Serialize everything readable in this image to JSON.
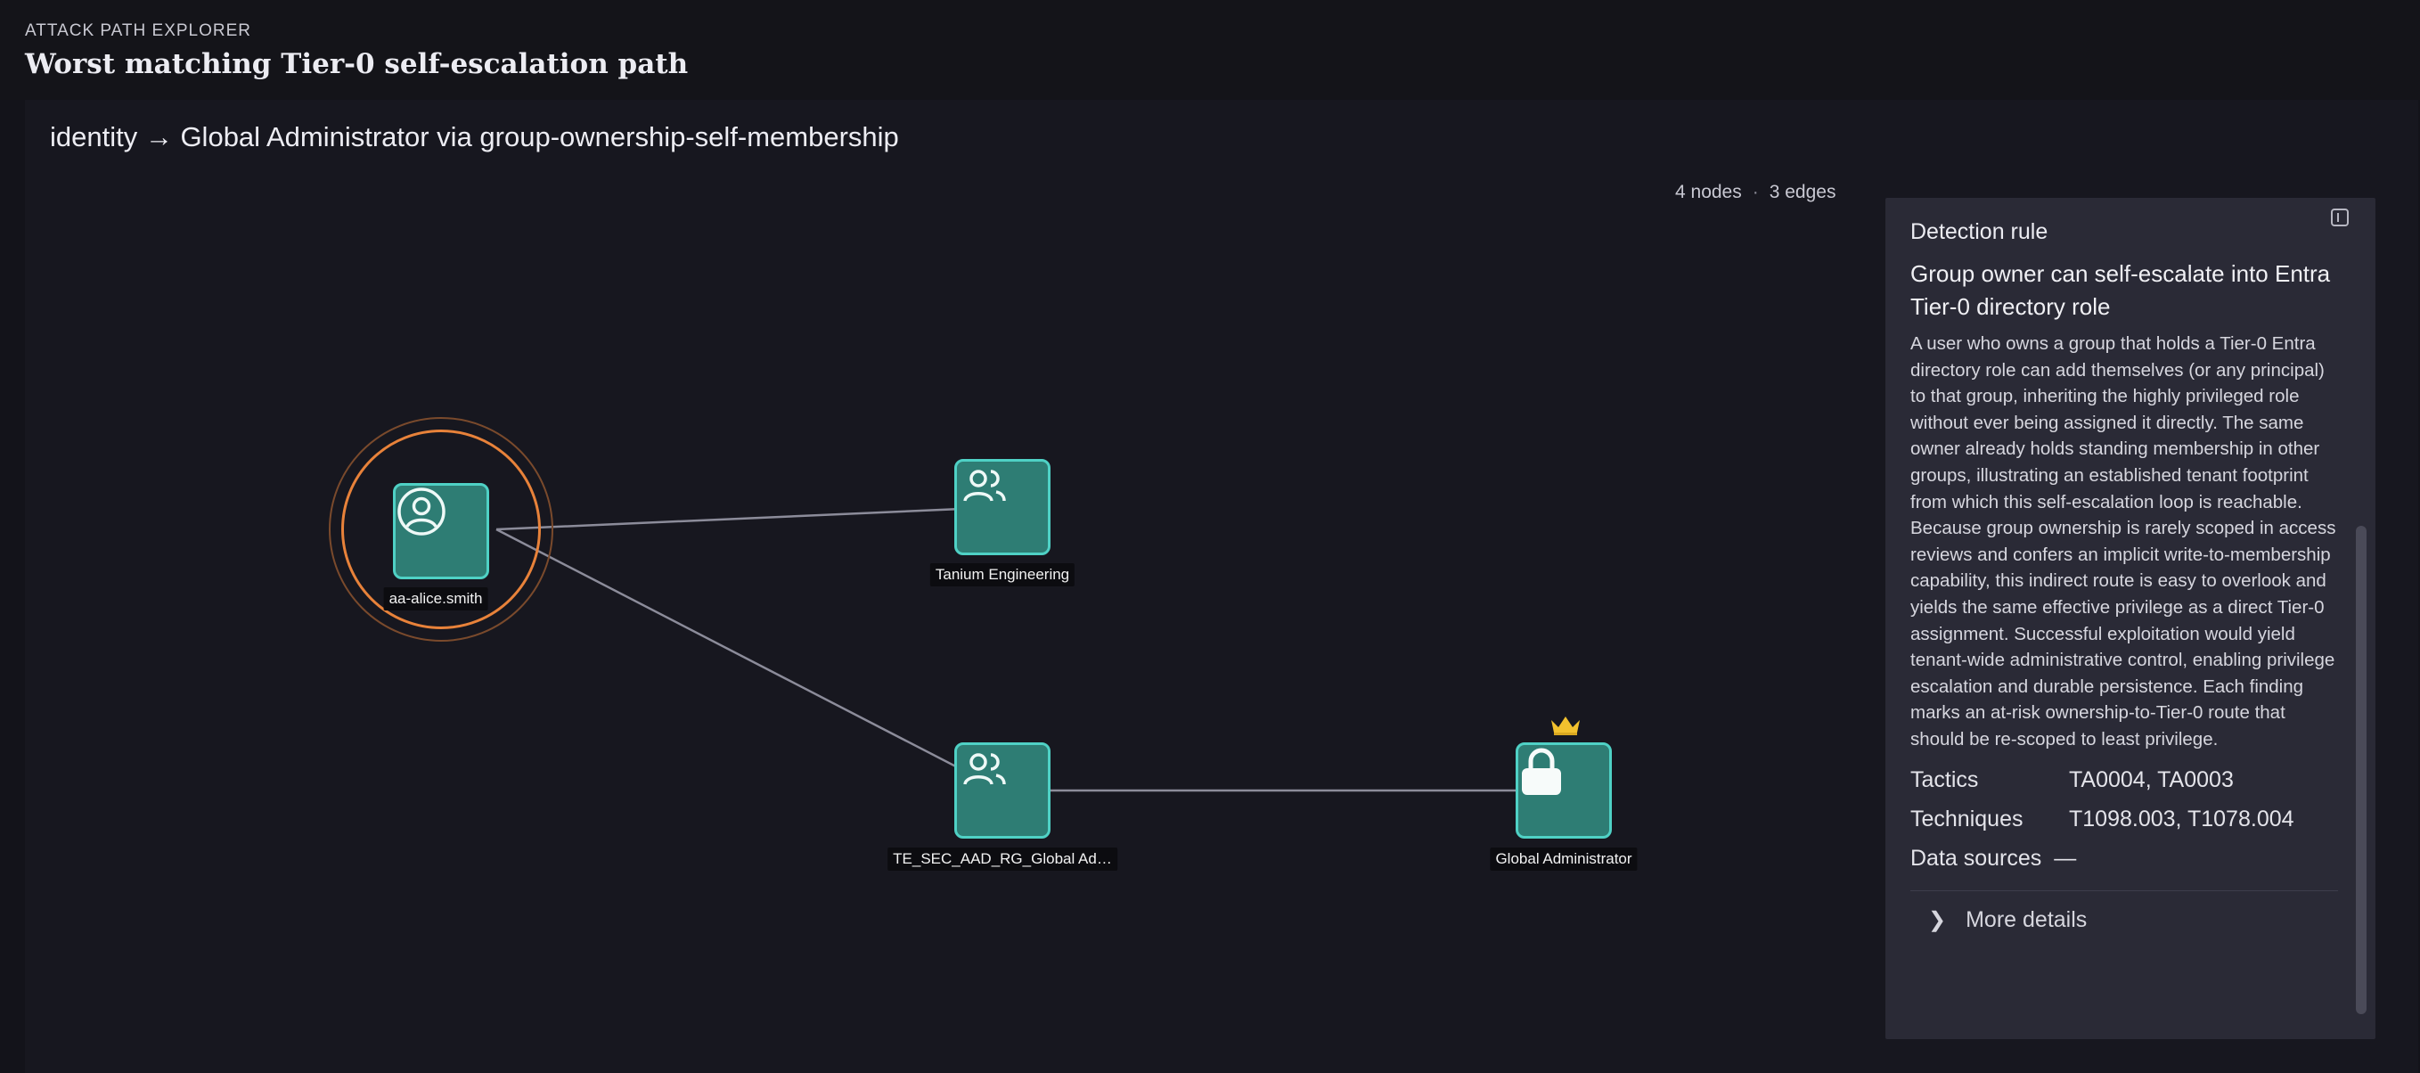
{
  "header": {
    "eyebrow": "ATTACK PATH EXPLORER",
    "title": "Worst matching Tier-0 self-escalation path"
  },
  "path": {
    "title": "identity → Global Administrator via group-ownership-self-membership",
    "stats": {
      "nodes": "4 nodes",
      "separator": "·",
      "edges": "3 edges"
    }
  },
  "graph": {
    "nodes": [
      {
        "id": "alice",
        "label": "aa-alice.smith",
        "icon": "user-circle-icon",
        "highlighted": true
      },
      {
        "id": "tanium",
        "label": "Tanium Engineering",
        "icon": "users-icon"
      },
      {
        "id": "tesec",
        "label": "TE_SEC_AAD_RG_Global Ad…",
        "icon": "users-icon"
      },
      {
        "id": "globaladmin",
        "label": "Global Administrator",
        "icon": "lock-icon",
        "badge": "crown-icon"
      }
    ],
    "edges": [
      {
        "from": "alice",
        "to": "tanium"
      },
      {
        "from": "alice",
        "to": "tesec"
      },
      {
        "from": "tesec",
        "to": "globaladmin"
      }
    ]
  },
  "sidebar": {
    "heading": "Detection rule",
    "rule_title": "Group owner can self-escalate into Entra Tier-0 directory role",
    "description": "A user who owns a group that holds a Tier-0 Entra directory role can add themselves (or any principal) to that group, inheriting the highly privileged role without ever being assigned it directly. The same owner already holds standing membership in other groups, illustrating an established tenant footprint from which this self-escalation loop is reachable. Because group ownership is rarely scoped in access reviews and confers an implicit write-to-membership capability, this indirect route is easy to overlook and yields the same effective privilege as a direct Tier-0 assignment. Successful exploitation would yield tenant-wide administrative control, enabling privilege escalation and durable persistence. Each finding marks an at-risk ownership-to-Tier-0 route that should be re-scoped to least privilege.",
    "tactics_label": "Tactics",
    "tactics_value": "TA0004, TA0003",
    "techniques_label": "Techniques",
    "techniques_value": "T1098.003, T1078.004",
    "data_sources_label": "Data sources",
    "data_sources_value": "—",
    "more_details": "More details"
  },
  "colors": {
    "node_fill": "#2e7d74",
    "node_border": "#4fd1c5",
    "highlight_ring": "#e8823a",
    "crown": "#f2c12e",
    "edge": "#8c8c9a"
  }
}
